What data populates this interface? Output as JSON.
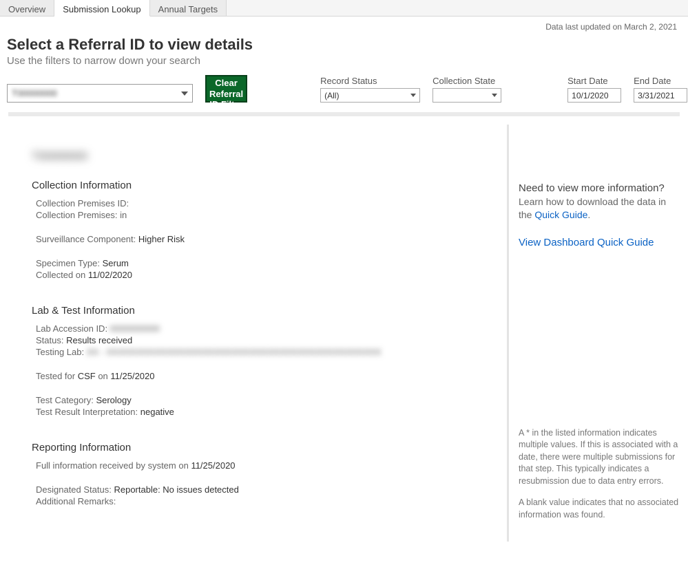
{
  "tabs": {
    "overview": "Overview",
    "submission": "Submission Lookup",
    "annual": "Annual Targets"
  },
  "last_updated": "Data last updated on March 2, 2021",
  "title": "Select a Referral ID to view details",
  "subtitle": "Use the filters to narrow down your search",
  "referral_select_value": "T00000000",
  "clear_button": "Clear Referral ID Filter",
  "filters": {
    "record_status_label": "Record Status",
    "record_status_value": "(All)",
    "collection_state_label": "Collection State",
    "collection_state_value": "",
    "start_date_label": "Start Date",
    "start_date_value": "10/1/2020",
    "end_date_label": "End Date",
    "end_date_value": "3/31/2021"
  },
  "detail": {
    "referral_id": "T00000000",
    "section_collection": "Collection Information",
    "collection_premises_id_label": "Collection Premises ID:",
    "collection_premises_label": "Collection Premises:  in",
    "surveillance_label": "Surveillance Component: ",
    "surveillance_value": "Higher Risk",
    "specimen_type_label": "Specimen Type: ",
    "specimen_type_value": "Serum",
    "collected_label": "Collected on ",
    "collected_value": "11/02/2020",
    "section_lab": "Lab & Test Information",
    "lab_accession_label": "Lab Accession ID: ",
    "lab_accession_value": "0000000000",
    "status_label": "Status: ",
    "status_value": "Results received",
    "testing_lab_label": "Testing Lab: ",
    "testing_lab_value": "XX - XXXXXXXXXXXXXXXXXXXXXXXXXXXXXXXXXXXXXXXXXXXXXX",
    "tested_for_prefix": "Tested for ",
    "tested_for_val": "CSF",
    "tested_on_mid": " on ",
    "tested_on_val": "11/25/2020",
    "test_category_label": "Test Category: ",
    "test_category_value": "Serology",
    "test_result_label": "Test Result Interpretation: ",
    "test_result_value": "negative",
    "section_reporting": "Reporting Information",
    "full_info_label": "Full information received by system on ",
    "full_info_value": "11/25/2020",
    "designated_label": "Designated Status: ",
    "designated_value": "Reportable: No issues detected",
    "remarks_label": "Additional Remarks:"
  },
  "side": {
    "title": "Need to view more information?",
    "text_prefix": "Learn how to download the data in the ",
    "quick_guide_link": "Quick Guide",
    "dot": ".",
    "dashboard_link": "View Dashboard Quick Guide",
    "footnote1": "A * in the listed information indicates multiple values. If this is associated with a date, there were multiple submissions for that step. This typically indicates a resubmission due to data entry errors.",
    "footnote2": "A blank value indicates that no associated information was found."
  }
}
